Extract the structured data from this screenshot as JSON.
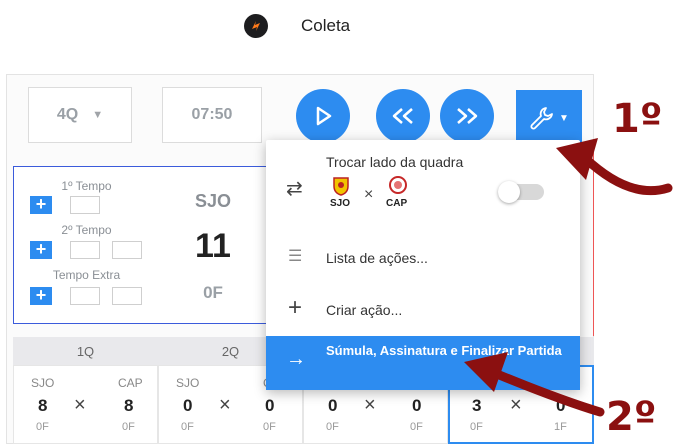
{
  "app": {
    "title": "Coleta"
  },
  "toolbar": {
    "quarter_value": "4Q",
    "clock_value": "07:50",
    "buttons": [
      "play-icon",
      "rewind-icon",
      "fast-forward-icon",
      "wrench-icon"
    ]
  },
  "timeouts": {
    "first_half": "1º Tempo",
    "second_half": "2º Tempo",
    "extra": "Tempo Extra",
    "add": "+"
  },
  "team": {
    "abbr": "SJO",
    "score": "11",
    "fouls": "0F"
  },
  "quarters": {
    "headers": [
      "1Q",
      "2Q"
    ],
    "cells": [
      {
        "home": "SJO",
        "away": "CAP",
        "home_score": "8",
        "away_score": "8",
        "home_fouls": "0F",
        "away_fouls": "0F"
      },
      {
        "home": "SJO",
        "away": "C",
        "home_score": "0",
        "away_score": "0",
        "home_fouls": "0F",
        "away_fouls": "0F"
      },
      {
        "home": "",
        "away": "",
        "home_score": "0",
        "away_score": "0",
        "home_fouls": "0F",
        "away_fouls": "0F"
      },
      {
        "home": "",
        "away": "",
        "home_score": "3",
        "away_score": "0",
        "home_fouls": "0F",
        "away_fouls": "1F"
      }
    ],
    "x": "×"
  },
  "menu": {
    "swap_label": "Trocar lado da quadra",
    "swap_home": "SJO",
    "swap_away": "CAP",
    "swap_x": "×",
    "actions_label": "Lista de ações...",
    "create_label": "Criar ação...",
    "finish_label": "Súmula, Assinatura e Finalizar Partida"
  },
  "annotations": {
    "step1": "1º",
    "step2": "2º"
  },
  "colors": {
    "accent": "#2d8cf0",
    "arrow": "#8b1010"
  }
}
